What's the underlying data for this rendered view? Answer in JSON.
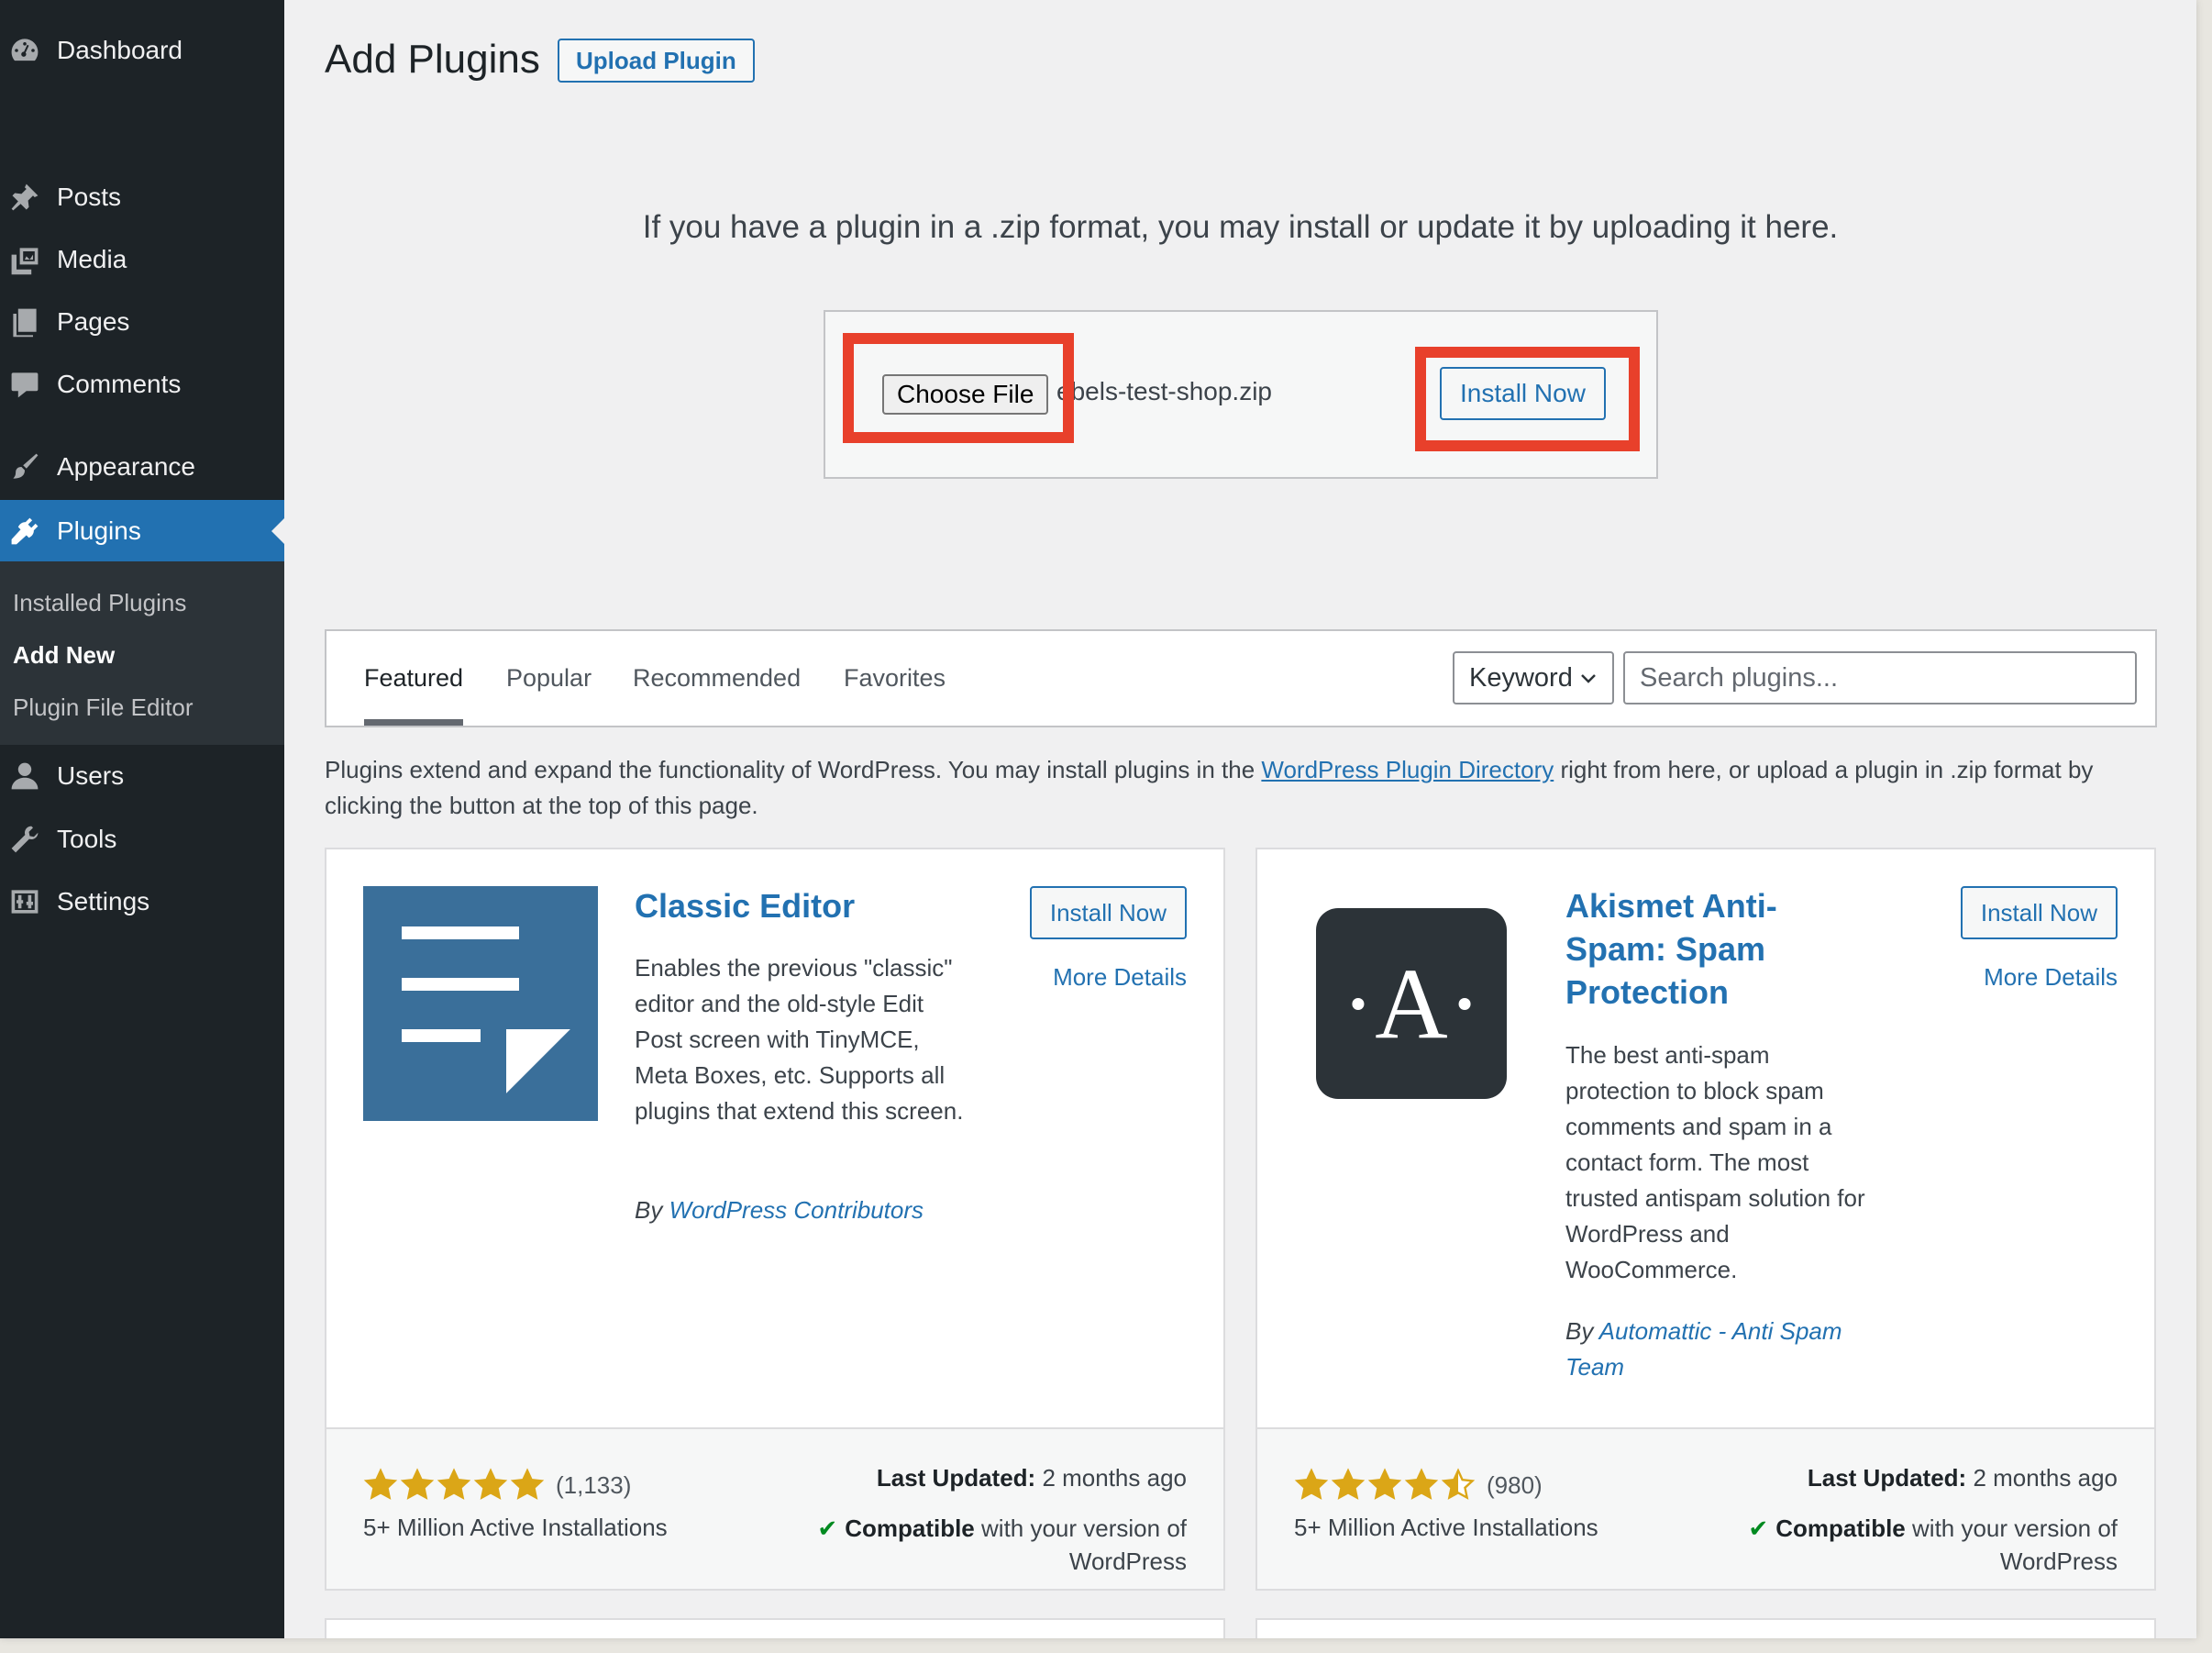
{
  "sidebar": {
    "items": [
      {
        "label": "Dashboard",
        "icon": "dashboard-icon"
      },
      {
        "label": "Posts",
        "icon": "pin-icon"
      },
      {
        "label": "Media",
        "icon": "media-icon"
      },
      {
        "label": "Pages",
        "icon": "pages-icon"
      },
      {
        "label": "Comments",
        "icon": "comment-icon"
      },
      {
        "label": "Appearance",
        "icon": "brush-icon"
      },
      {
        "label": "Plugins",
        "icon": "plugin-icon"
      },
      {
        "label": "Users",
        "icon": "user-icon"
      },
      {
        "label": "Tools",
        "icon": "wrench-icon"
      },
      {
        "label": "Settings",
        "icon": "settings-icon"
      }
    ],
    "submenu": [
      "Installed Plugins",
      "Add New",
      "Plugin File Editor"
    ],
    "active_item": "Plugins",
    "current_submenu": "Add New"
  },
  "header": {
    "title": "Add Plugins",
    "upload_button": "Upload Plugin"
  },
  "upload": {
    "help_text": "If you have a plugin in a .zip format, you may install or update it by uploading it here.",
    "choose_file_label": "Choose File",
    "file_name": "ebels-test-shop.zip",
    "install_label": "Install Now"
  },
  "filter": {
    "tabs": [
      "Featured",
      "Popular",
      "Recommended",
      "Favorites"
    ],
    "current_tab": "Featured",
    "search_type": "Keyword",
    "search_placeholder": "Search plugins..."
  },
  "intro": {
    "text_before": "Plugins extend and expand the functionality of WordPress. You may install plugins in the ",
    "link": "WordPress Plugin Directory",
    "text_after": " right from here, or upload a plugin in .zip format by clicking the button at the top of this page."
  },
  "plugins": [
    {
      "name": "Classic Editor",
      "description": "Enables the previous \"classic\" editor and the old-style Edit Post screen with TinyMCE, Meta Boxes, etc. Supports all plugins that extend this screen.",
      "by": "By ",
      "author": "WordPress Contributors",
      "install_label": "Install Now",
      "details_label": "More Details",
      "rating": 5,
      "rating_count": "(1,133)",
      "installs": "5+ Million Active Installations",
      "updated_label": "Last Updated:",
      "updated_value": "2 months ago",
      "compat_bold": "Compatible",
      "compat_rest": "with your version of WordPress"
    },
    {
      "name": "Akismet Anti-Spam: Spam Protection",
      "description": "The best anti-spam protection to block spam comments and spam in a contact form. The most trusted antispam solution for WordPress and WooCommerce.",
      "by": "By ",
      "author": "Automattic - Anti Spam Team",
      "install_label": "Install Now",
      "details_label": "More Details",
      "rating": 4.5,
      "rating_count": "(980)",
      "installs": "5+ Million Active Installations",
      "updated_label": "Last Updated:",
      "updated_value": "2 months ago",
      "compat_bold": "Compatible",
      "compat_rest": "with your version of WordPress",
      "logo_letter": "·A·"
    }
  ],
  "colors": {
    "sidebar_bg": "#1d2327",
    "accent": "#2271b1",
    "highlight": "#e8402b",
    "star": "#dba617"
  }
}
